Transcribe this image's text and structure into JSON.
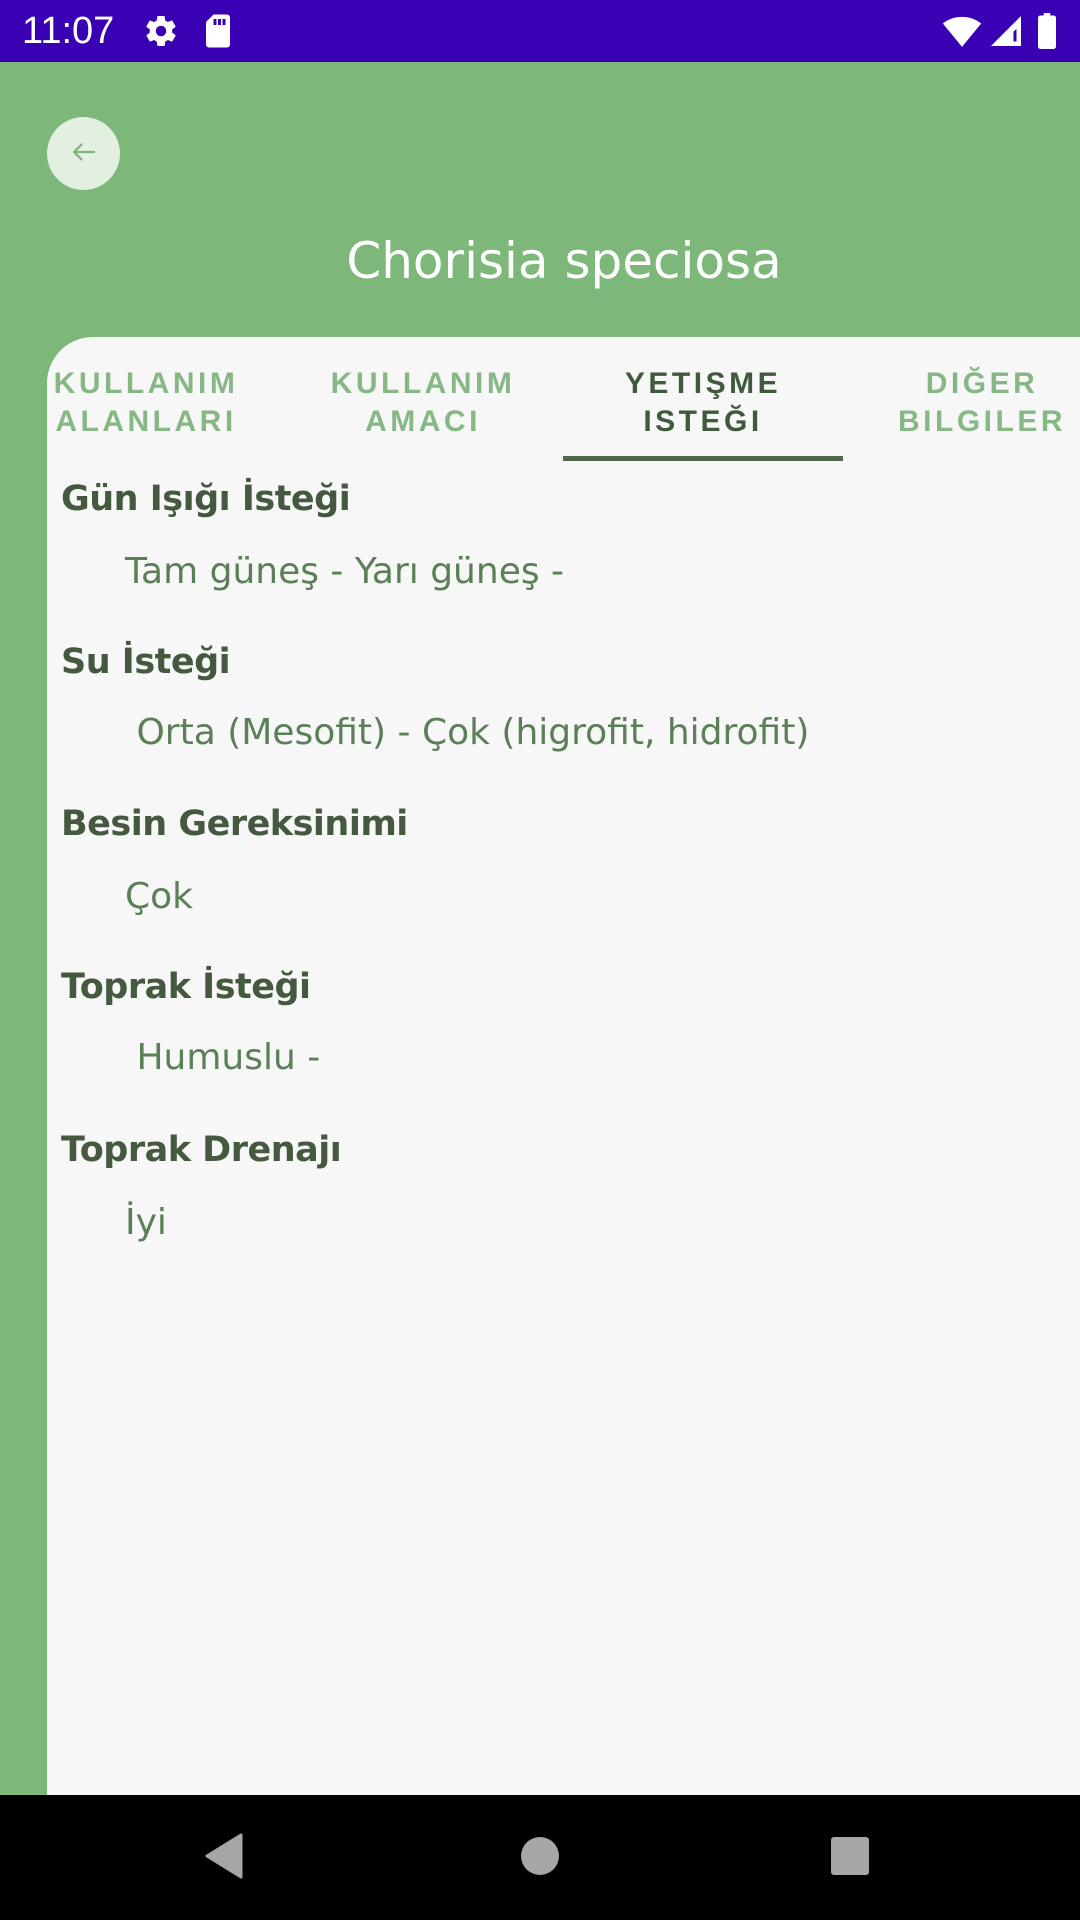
{
  "status_bar": {
    "time": "11:07",
    "icons": [
      "gear-icon",
      "sd-card-icon",
      "wifi-icon",
      "signal-icon",
      "battery-icon"
    ],
    "background": "#3a00b3"
  },
  "header": {
    "title": "Chorisia speciosa",
    "back_icon": "arrow-left-icon",
    "background": "#7db77a"
  },
  "tabs": [
    {
      "label": "KULLANIM\nALANLARI",
      "active": false
    },
    {
      "label": "KULLANIM\nAMACI",
      "active": false
    },
    {
      "label": "YETIŞME\nISTEĞI",
      "active": true
    },
    {
      "label": "DIĞER\nBILGILER",
      "active": false
    }
  ],
  "sections": [
    {
      "heading": "Gün Işığı İsteği",
      "value": "Tam güneş - Yarı güneş -"
    },
    {
      "heading": "Su İsteği",
      "value": " Orta (Mesofit) - Çok (higrofit, hidrofit)"
    },
    {
      "heading": "Besin Gereksinimi",
      "value": "Çok"
    },
    {
      "heading": "Toprak İsteği",
      "value": " Humuslu -"
    },
    {
      "heading": "Toprak Drenajı",
      "value": "İyi"
    }
  ],
  "colors": {
    "accent_green": "#7db77a",
    "heading_text": "#44593f",
    "value_text": "#5b7f56",
    "tab_inactive": "#86b784",
    "tab_active": "#3f5a3d"
  },
  "nav_bar": {
    "icons": [
      "back-triangle-icon",
      "home-circle-icon",
      "recents-square-icon"
    ]
  }
}
